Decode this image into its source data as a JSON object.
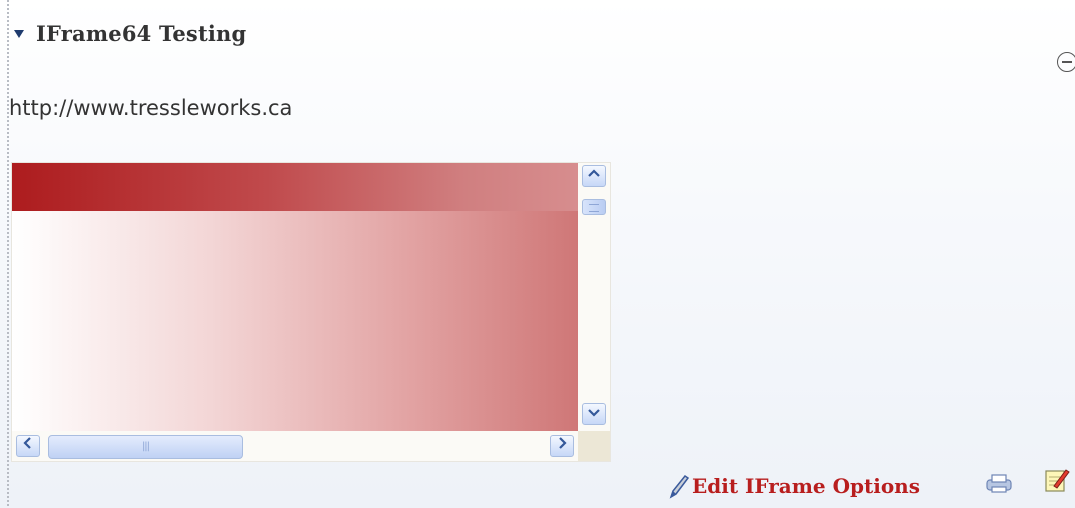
{
  "portlet": {
    "title": "IFrame64 Testing",
    "url": "http://www.tressleworks.ca"
  },
  "scrollbar": {
    "thumb_grip": "|||"
  },
  "footer": {
    "edit_label": "Edit IFrame Options"
  },
  "icons": {
    "collapse": "collapse-arrow-icon",
    "minimize": "minimize-icon",
    "edit": "pencil-icon",
    "print": "print-icon",
    "note": "note-icon"
  },
  "colors": {
    "banner_red": "#ad1c1e",
    "link_red": "#b81e1e",
    "title_text": "#333333",
    "scroll_blue": "#c6d7f7"
  }
}
